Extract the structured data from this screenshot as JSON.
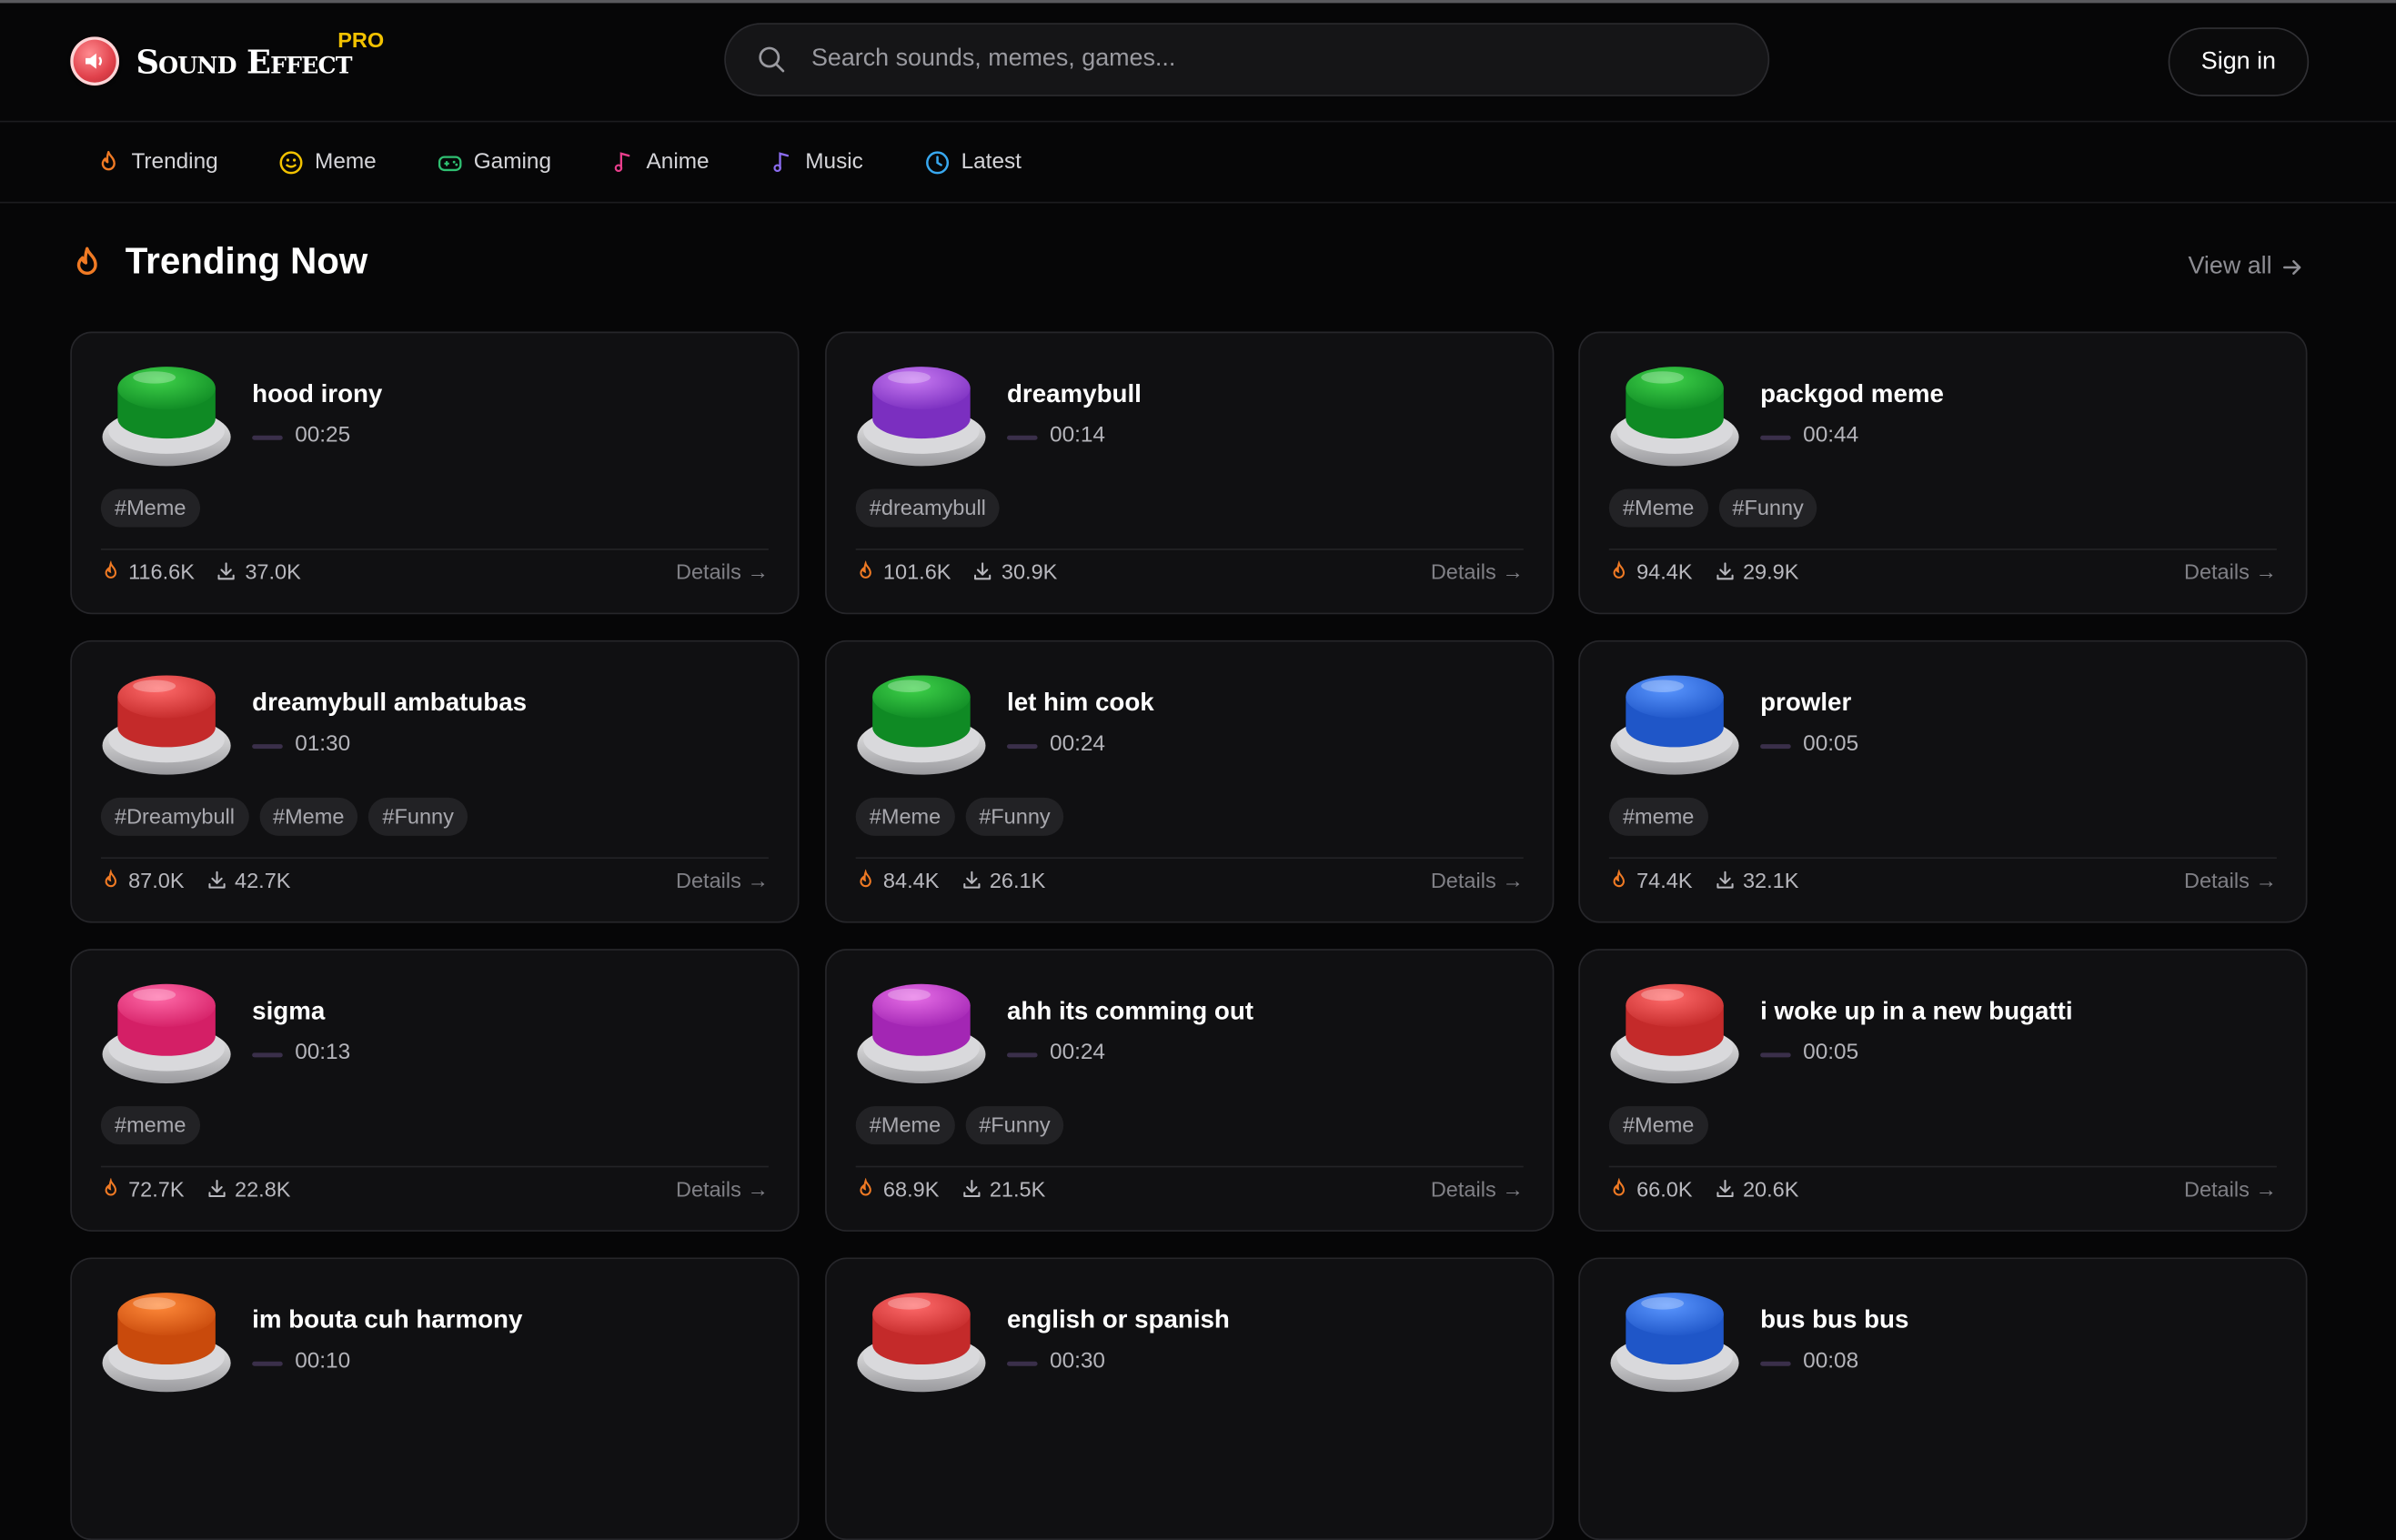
{
  "brand": {
    "name": "Sound Effect",
    "badge": "PRO"
  },
  "search": {
    "placeholder": "Search sounds, memes, games..."
  },
  "auth": {
    "signin_label": "Sign in"
  },
  "nav": {
    "items": [
      {
        "label": "Trending",
        "icon": "flame-icon",
        "color": "#f07a24"
      },
      {
        "label": "Meme",
        "icon": "smiley-icon",
        "color": "#f2c200"
      },
      {
        "label": "Gaming",
        "icon": "gamepad-icon",
        "color": "#2fbf71"
      },
      {
        "label": "Anime",
        "icon": "music-note-icon",
        "color": "#e83e8c"
      },
      {
        "label": "Music",
        "icon": "music-note-icon",
        "color": "#8b6cf0"
      },
      {
        "label": "Latest",
        "icon": "clock-icon",
        "color": "#38a8f0"
      }
    ]
  },
  "section": {
    "title": "Trending Now",
    "view_all": "View all"
  },
  "cards": [
    {
      "title": "hood irony",
      "duration": "00:25",
      "tags": [
        "#Meme"
      ],
      "plays": "116.6K",
      "downloads": "37.0K",
      "details": "Details →",
      "button_color": "green"
    },
    {
      "title": "dreamybull",
      "duration": "00:14",
      "tags": [
        "#dreamybull"
      ],
      "plays": "101.6K",
      "downloads": "30.9K",
      "details": "Details →",
      "button_color": "purple"
    },
    {
      "title": "packgod meme",
      "duration": "00:44",
      "tags": [
        "#Meme",
        "#Funny"
      ],
      "plays": "94.4K",
      "downloads": "29.9K",
      "details": "Details →",
      "button_color": "green"
    },
    {
      "title": "dreamybull ambatubas",
      "duration": "01:30",
      "tags": [
        "#Dreamybull",
        "#Meme",
        "#Funny"
      ],
      "plays": "87.0K",
      "downloads": "42.7K",
      "details": "Details →",
      "button_color": "red"
    },
    {
      "title": "let him cook",
      "duration": "00:24",
      "tags": [
        "#Meme",
        "#Funny"
      ],
      "plays": "84.4K",
      "downloads": "26.1K",
      "details": "Details →",
      "button_color": "green"
    },
    {
      "title": "prowler",
      "duration": "00:05",
      "tags": [
        "#meme"
      ],
      "plays": "74.4K",
      "downloads": "32.1K",
      "details": "Details →",
      "button_color": "blue"
    },
    {
      "title": "sigma",
      "duration": "00:13",
      "tags": [
        "#meme"
      ],
      "plays": "72.7K",
      "downloads": "22.8K",
      "details": "Details →",
      "button_color": "pink"
    },
    {
      "title": "ahh its comming out",
      "duration": "00:24",
      "tags": [
        "#Meme",
        "#Funny"
      ],
      "plays": "68.9K",
      "downloads": "21.5K",
      "details": "Details →",
      "button_color": "magenta"
    },
    {
      "title": "i woke up in a new bugatti",
      "duration": "00:05",
      "tags": [
        "#Meme"
      ],
      "plays": "66.0K",
      "downloads": "20.6K",
      "details": "Details →",
      "button_color": "red"
    },
    {
      "title": "im bouta cuh harmony",
      "duration": "00:10",
      "tags": [],
      "plays": "",
      "downloads": "",
      "details": "",
      "button_color": "orange"
    },
    {
      "title": "english or spanish",
      "duration": "00:30",
      "tags": [],
      "plays": "",
      "downloads": "",
      "details": "",
      "button_color": "red"
    },
    {
      "title": "bus bus bus",
      "duration": "00:08",
      "tags": [],
      "plays": "",
      "downloads": "",
      "details": "",
      "button_color": "blue"
    }
  ],
  "palette": {
    "green": [
      "#3fd24a",
      "#0f8a24"
    ],
    "purple": [
      "#c87af2",
      "#7b2fc0"
    ],
    "red": [
      "#ff6b6b",
      "#c42a2a"
    ],
    "blue": [
      "#5a96ff",
      "#1f56c8"
    ],
    "pink": [
      "#ff6aa8",
      "#d41f66"
    ],
    "magenta": [
      "#e66ee6",
      "#a326b4"
    ],
    "orange": [
      "#ff8a3a",
      "#c94a0c"
    ],
    "flame": "#f07a24",
    "background": "#060607",
    "card": "#101012"
  }
}
